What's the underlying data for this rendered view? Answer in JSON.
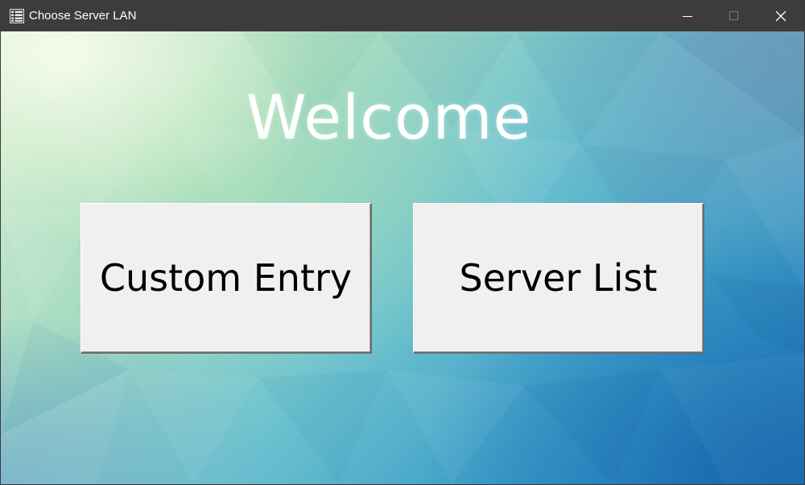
{
  "window": {
    "title": "Choose Server LAN",
    "app_icon": "list-window-icon",
    "controls": {
      "minimize_icon": "minimize-icon",
      "maximize_icon": "maximize-icon",
      "close_icon": "close-icon"
    }
  },
  "main": {
    "heading": "Welcome",
    "buttons": {
      "custom_entry": "Custom Entry",
      "server_list": "Server List"
    }
  },
  "colors": {
    "titlebar": "#3c3c3c",
    "title_text": "#ffffff",
    "button_face": "#f0f0f0",
    "background_top_left": "#dff1d8",
    "background_bottom_right": "#2272b5"
  }
}
